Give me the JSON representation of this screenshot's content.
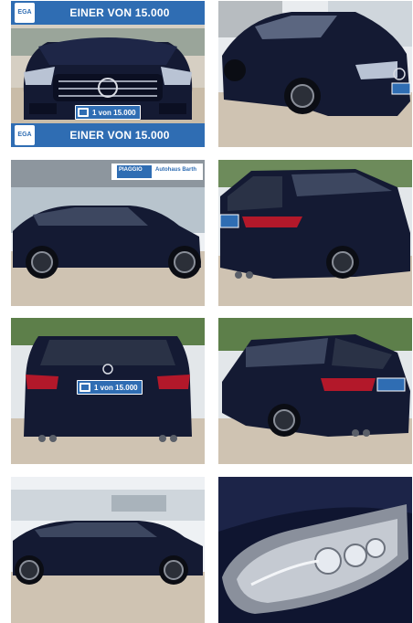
{
  "gallery": {
    "banner_top_text": "EINER VON 15.000",
    "banner_bottom_text": "EINER VON 15.000",
    "banner_logo_text": "EGA",
    "plate_text": "1 von 15.000",
    "dealer_sign_text": "PIAGGIO",
    "dealer_sign_right": "Autohaus Barth",
    "images": [
      {
        "view": "front"
      },
      {
        "view": "front-three-quarter"
      },
      {
        "view": "side-left"
      },
      {
        "view": "rear-three-quarter-left"
      },
      {
        "view": "rear"
      },
      {
        "view": "rear-three-quarter-right"
      },
      {
        "view": "side-left-wide"
      },
      {
        "view": "headlight-closeup"
      }
    ],
    "colors": {
      "banner": "#2f6db3",
      "car_paint": "#141a33",
      "gravel": "#cbbfae",
      "sky": "#eef1f4",
      "foliage": "#4a6b3a"
    }
  }
}
